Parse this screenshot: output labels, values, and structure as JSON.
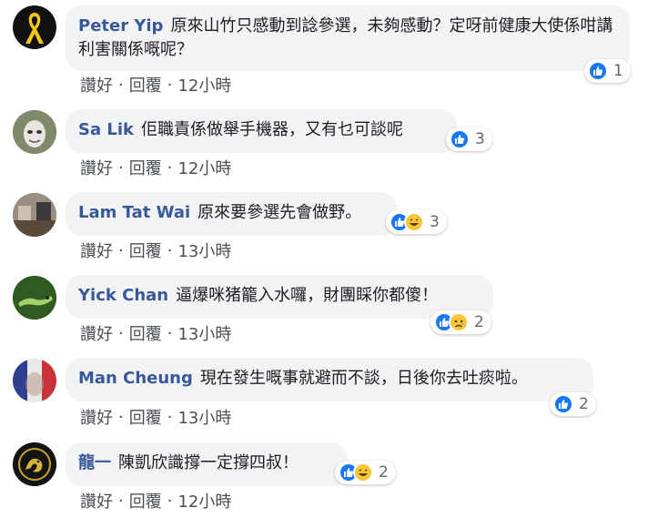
{
  "comments": [
    {
      "author": "Peter Yip",
      "text": "原來山竹只感動到諗參選，未夠感動？定呀前健康大使係咁講利害關係嘅呢？",
      "reactions": [
        "like"
      ],
      "reaction_count": "1",
      "like_label": "讚好",
      "reply_label": "回覆",
      "separator": "·",
      "time": "12小時",
      "avatar": "yellow-ribbon-avatar"
    },
    {
      "author": "Sa Lik",
      "text": "佢職責係做舉手機器，又有乜可談呢",
      "reactions": [
        "like"
      ],
      "reaction_count": "3",
      "like_label": "讚好",
      "reply_label": "回覆",
      "separator": "·",
      "time": "12小時",
      "avatar": "mask-face-avatar"
    },
    {
      "author": "Lam Tat Wai",
      "text": "原來要參選先會做野。",
      "reactions": [
        "like",
        "haha"
      ],
      "reaction_count": "3",
      "like_label": "讚好",
      "reply_label": "回覆",
      "separator": "·",
      "time": "13小時",
      "avatar": "room-photo-avatar"
    },
    {
      "author": "Yick Chan",
      "text": "逼爆咪猪籠入水囉，財團睬你都傻！",
      "reactions": [
        "like",
        "sad"
      ],
      "reaction_count": "2",
      "like_label": "讚好",
      "reply_label": "回覆",
      "separator": "·",
      "time": "13小時",
      "avatar": "green-lizard-avatar"
    },
    {
      "author": "Man Cheung",
      "text": "現在發生嘅事就避而不談，日後你去吐痰啦。",
      "reactions": [
        "like"
      ],
      "reaction_count": "2",
      "like_label": "讚好",
      "reply_label": "回覆",
      "separator": "·",
      "time": "13小時",
      "avatar": "french-flag-avatar"
    },
    {
      "author": "龍一",
      "text": "陳凱欣識撐一定撐四叔！",
      "reactions": [
        "like",
        "haha"
      ],
      "reaction_count": "2",
      "like_label": "讚好",
      "reply_label": "回覆",
      "separator": "·",
      "time": "12小時",
      "avatar": "golden-dragon-avatar"
    }
  ],
  "colors": {
    "author": "#385898",
    "bubble": "#f2f3f5",
    "like": "#1877f2",
    "emoji": "#f7c53a"
  }
}
